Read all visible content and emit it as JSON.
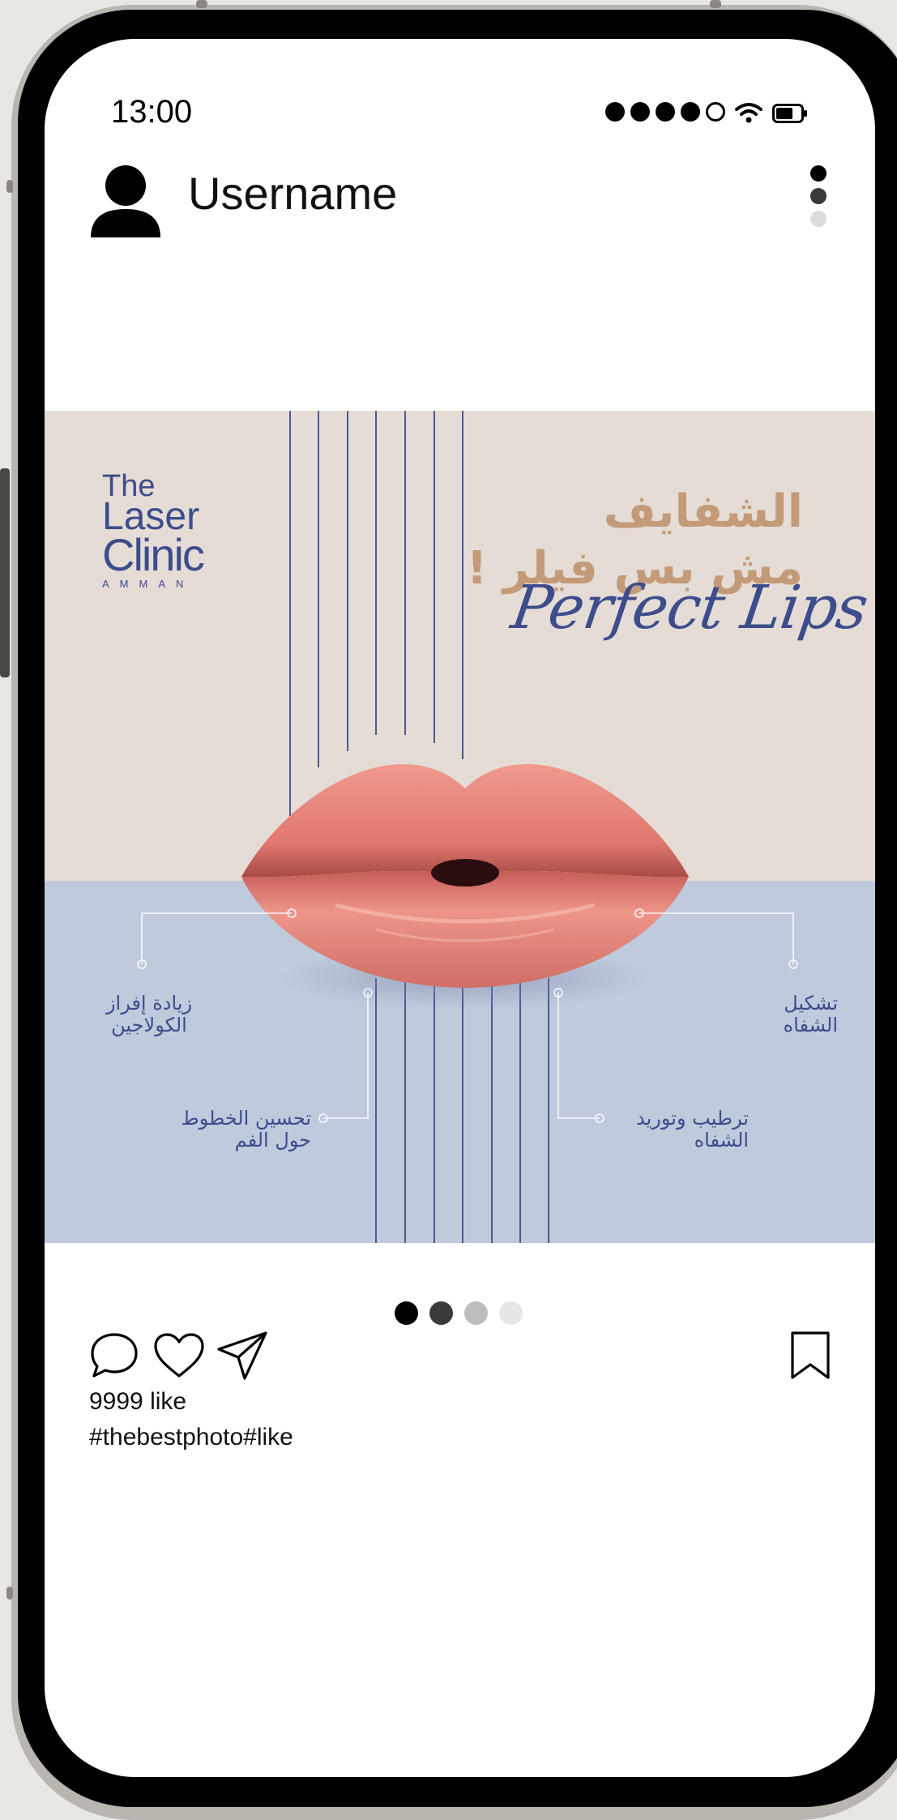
{
  "status_bar": {
    "time": "13:00",
    "signal_icon": "signal-dots-icon",
    "wifi_icon": "wifi-icon",
    "battery_icon": "battery-icon"
  },
  "header": {
    "avatar_icon": "user-silhouette-icon",
    "username": "Username",
    "menu_icon": "vertical-dots-icon"
  },
  "post": {
    "logo": {
      "line1": "The",
      "line2": "Laser",
      "line3": "Clinic",
      "line4": "AMMAN"
    },
    "headline_line1": "الشفايف",
    "headline_line2": "مش بس فيلر !",
    "script_text": "Perfect Lips",
    "callouts": {
      "top_left_line1": "زيادة إفراز",
      "top_left_line2": "الكولاجين",
      "top_right_line1": "تشكيل",
      "top_right_line2": "الشفاه",
      "bottom_left_line1": "تحسين الخطوط",
      "bottom_left_line2": "حول الفم",
      "bottom_right_line1": "ترطيب وتوريد",
      "bottom_right_line2": "الشفاه"
    },
    "colors": {
      "top_background": "#e5dcd6",
      "bottom_background": "#bfcadd",
      "headline": "#c39b78",
      "navy": "#3d4d8c",
      "lips": "#e07f75"
    }
  },
  "carousel": {
    "page_count": 4,
    "dot_colors": [
      "#000000",
      "#3a3a3a",
      "#bdbdbd",
      "#e6e6e6"
    ]
  },
  "actions": {
    "comment_icon": "comment-bubble-icon",
    "like_icon": "heart-icon",
    "share_icon": "paper-plane-icon",
    "save_icon": "bookmark-icon"
  },
  "likes_text": "9999 like",
  "caption": "#thebestphoto#like"
}
